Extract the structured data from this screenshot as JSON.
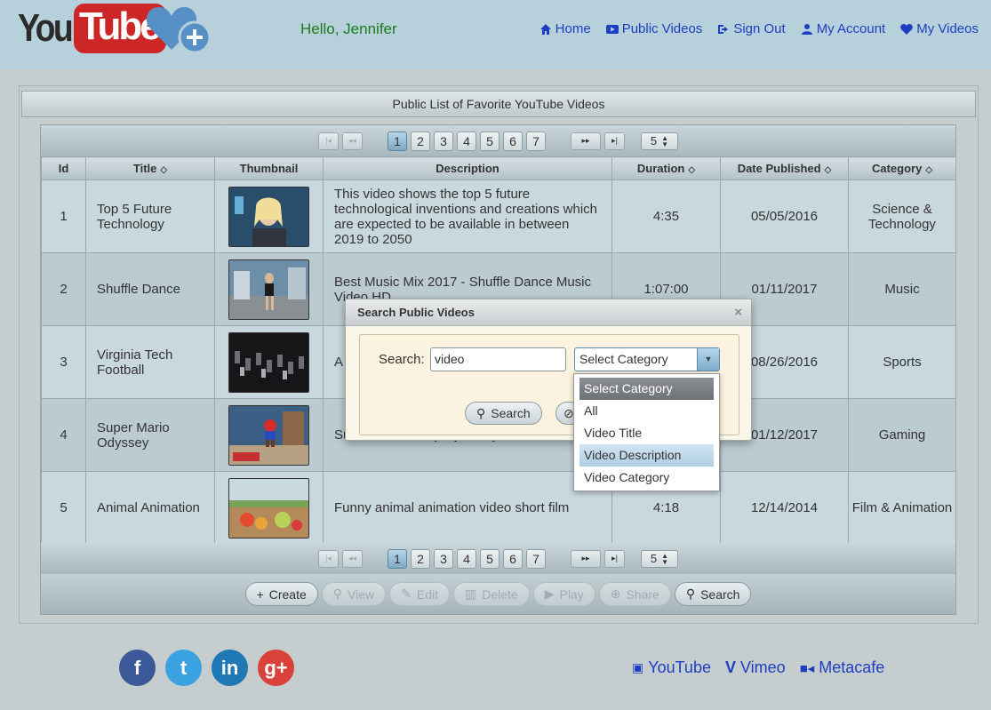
{
  "header": {
    "logo_you": "You",
    "logo_tube": "Tube",
    "greeting": "Hello, Jennifer",
    "nav": [
      {
        "label": "Home",
        "icon": "home-icon"
      },
      {
        "label": "Public Videos",
        "icon": "video-icon"
      },
      {
        "label": "Sign Out",
        "icon": "sign-out-icon"
      },
      {
        "label": "My Account",
        "icon": "user-icon"
      },
      {
        "label": "My Videos",
        "icon": "heart-icon"
      }
    ]
  },
  "panel": {
    "title": "Public List of Favorite YouTube Videos"
  },
  "pager": {
    "pages": [
      "1",
      "2",
      "3",
      "4",
      "5",
      "6",
      "7"
    ],
    "current_page": "1",
    "rows_per_page": "5"
  },
  "table": {
    "columns": [
      "Id",
      "Title",
      "Thumbnail",
      "Description",
      "Duration",
      "Date Published",
      "Category"
    ],
    "rows": [
      {
        "id": "1",
        "title": "Top 5 Future Technology",
        "description": "This video shows the top 5 future technological inventions and creations which are expected to be available in between 2019 to 2050",
        "duration": "4:35",
        "date": "05/05/2016",
        "category": "Science & Technology"
      },
      {
        "id": "2",
        "title": "Shuffle Dance",
        "description": "Best Music Mix 2017 - Shuffle Dance Music Video HD",
        "duration": "1:07:00",
        "date": "01/11/2017",
        "category": "Music"
      },
      {
        "id": "3",
        "title": "Virginia Tech Football",
        "description": "A",
        "duration": "",
        "date": "08/26/2016",
        "category": "Sports"
      },
      {
        "id": "4",
        "title": "Super Mario Odyssey",
        "description": "Su M sandbox-style journey!",
        "duration": "",
        "date": "01/12/2017",
        "category": "Gaming"
      },
      {
        "id": "5",
        "title": "Animal Animation",
        "description": "Funny animal animation video short film",
        "duration": "4:18",
        "date": "12/14/2014",
        "category": "Film & Animation"
      }
    ]
  },
  "toolbar": {
    "create": "Create",
    "view": "View",
    "edit": "Edit",
    "delete": "Delete",
    "play": "Play",
    "share": "Share",
    "search": "Search"
  },
  "dialog": {
    "title": "Search Public Videos",
    "close": "×",
    "search_label": "Search:",
    "search_value": "video",
    "category_selected": "Select Category",
    "search_button": "Search",
    "category_options": [
      "Select Category",
      "All",
      "Video Title",
      "Video Description",
      "Video Category"
    ],
    "highlighted_option": "Video Description"
  },
  "footer": {
    "links": [
      {
        "label": "YouTube",
        "icon": "youtube-icon"
      },
      {
        "label": "Vimeo",
        "icon": "vimeo-icon"
      },
      {
        "label": "Metacafe",
        "icon": "camera-icon"
      }
    ],
    "social": [
      {
        "name": "facebook",
        "glyph": "f",
        "color": "#3b5998"
      },
      {
        "name": "twitter",
        "glyph": "t",
        "color": "#3aa2e0"
      },
      {
        "name": "linkedin",
        "glyph": "in",
        "color": "#1f78b4"
      },
      {
        "name": "google-plus",
        "glyph": "g+",
        "color": "#d9413a"
      }
    ]
  },
  "colors": {
    "header_bg": "#b6d1db",
    "link": "#1e3ec2",
    "greeting": "#1e7a1e",
    "logo_red": "#cd2626"
  }
}
